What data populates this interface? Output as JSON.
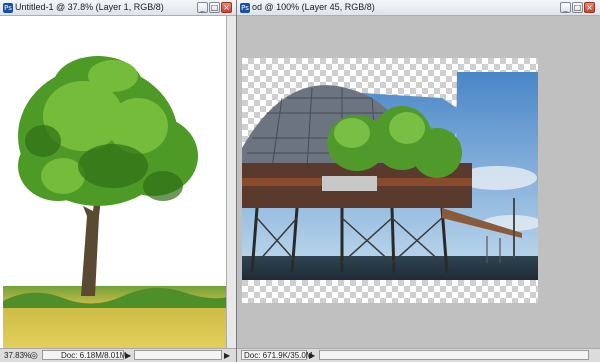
{
  "left_window": {
    "title": "Untitled-1 @ 37.8% (Layer 1, RGB/8)",
    "zoom": "37.83%",
    "doc_info": "Doc: 6.18M/8.01M"
  },
  "right_window": {
    "title": "od @ 100% (Layer 45, RGB/8)",
    "doc_info": "Doc: 671.9K/35.0M"
  },
  "icons": {
    "minimize": "minimize-icon",
    "maximize": "maximize-icon",
    "close": "close-icon"
  }
}
